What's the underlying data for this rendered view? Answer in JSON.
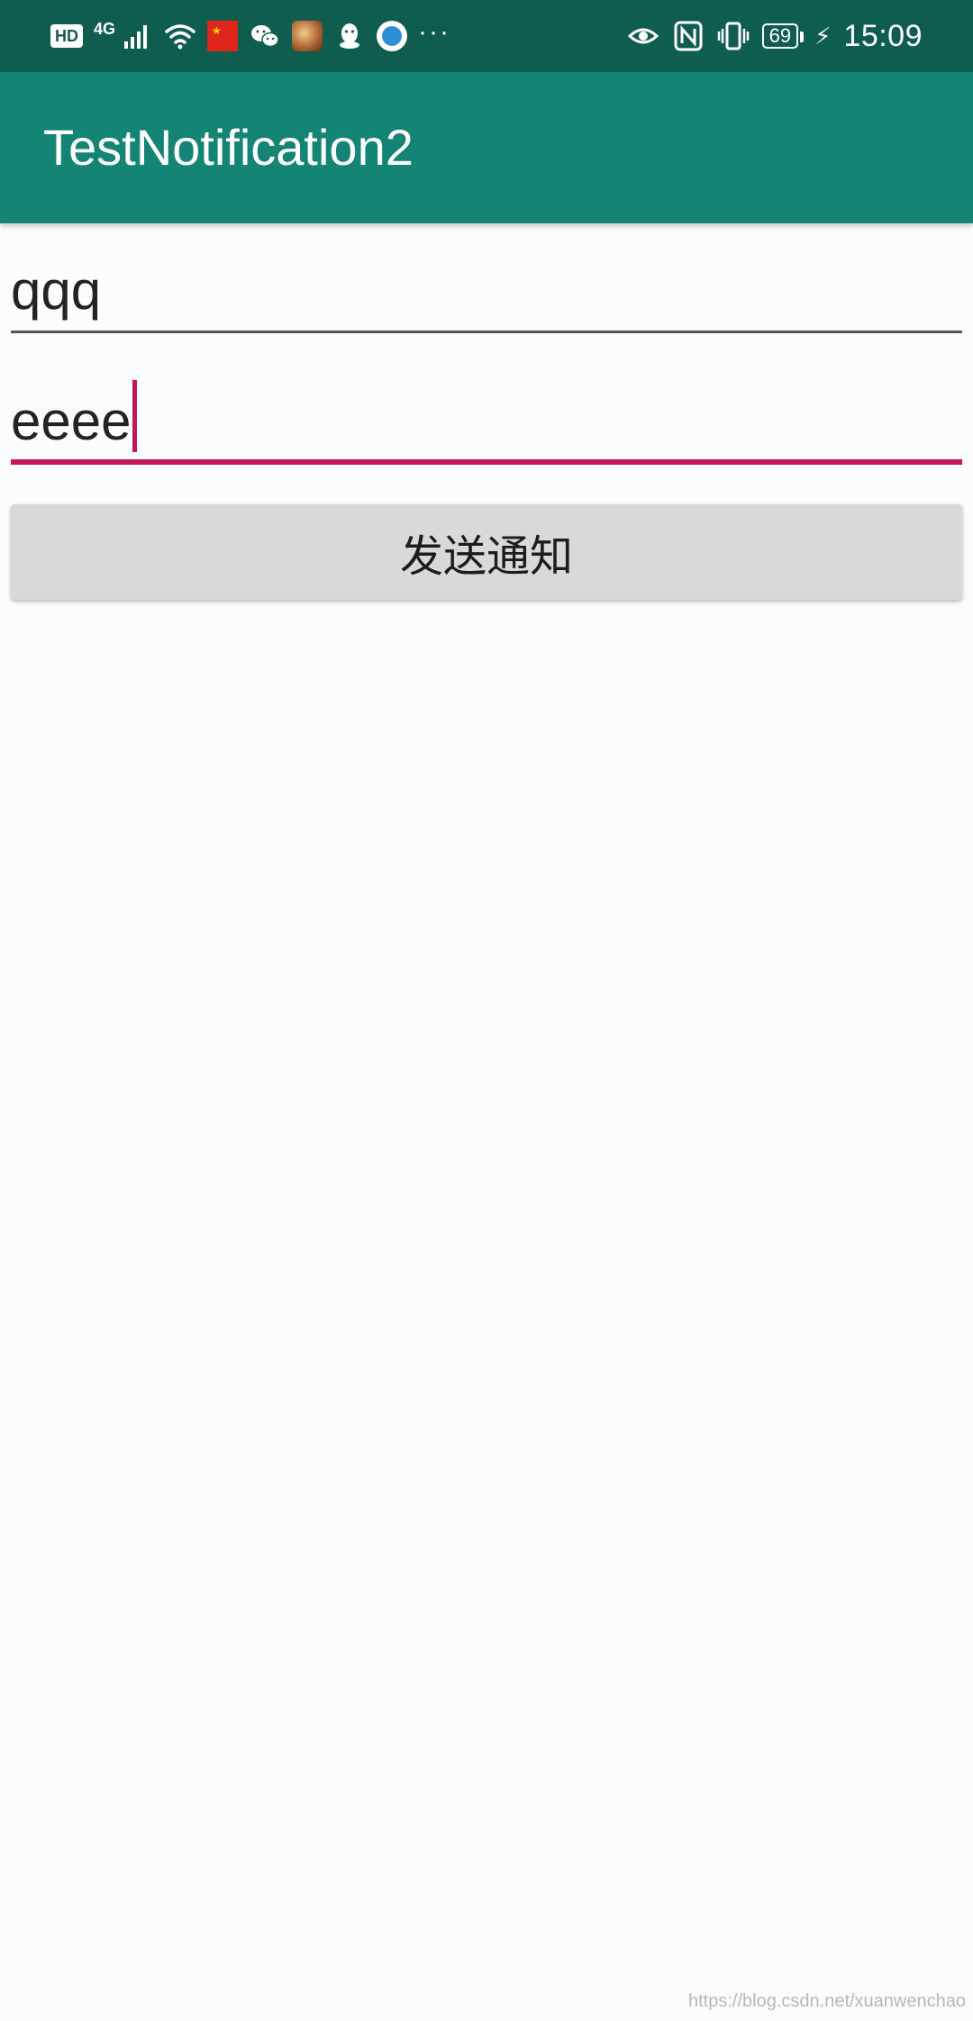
{
  "status_bar": {
    "hd": "HD",
    "network": "4G",
    "left_icons": [
      "signal-icon",
      "wifi-icon",
      "flag-icon",
      "wechat-icon",
      "game-avatar-icon",
      "qq-icon",
      "browser-icon"
    ],
    "more": "···",
    "right_icons": [
      "eye-icon",
      "nfc-icon",
      "vibrate-icon",
      "battery-icon",
      "charging-icon"
    ],
    "battery": "69",
    "time": "15:09"
  },
  "app_bar": {
    "title": "TestNotification2"
  },
  "form": {
    "field1_value": "qqq",
    "field2_value": "eeee",
    "send_button_label": "发送通知"
  },
  "watermark": "https://blog.csdn.net/xuanwenchao",
  "colors": {
    "status_bar": "#0f5d4f",
    "app_bar": "#148474",
    "accent": "#c2185b",
    "button": "#d7d9da",
    "background": "#fbfcfd"
  }
}
